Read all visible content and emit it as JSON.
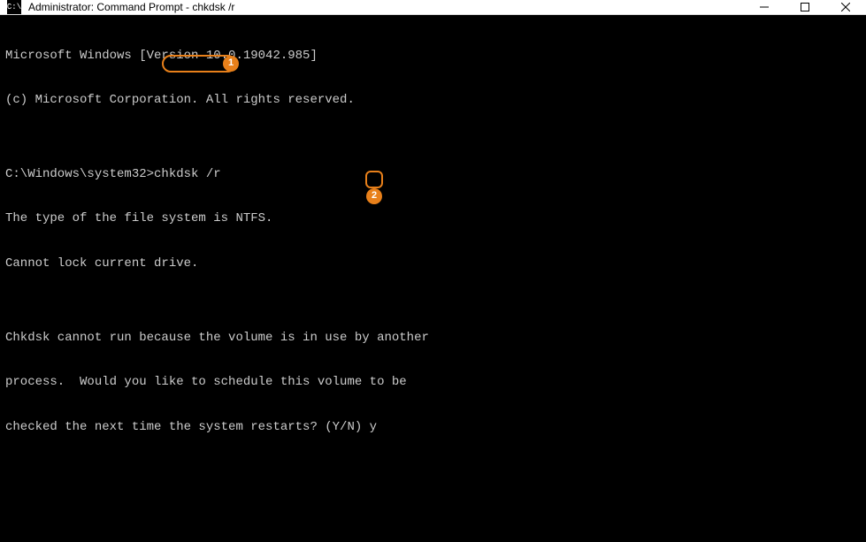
{
  "window": {
    "title": "Administrator: Command Prompt - chkdsk  /r",
    "icon_text": "C:\\"
  },
  "controls": {
    "minimize": "minimize",
    "maximize": "maximize",
    "close": "close"
  },
  "terminal": {
    "lines": [
      "Microsoft Windows [Version 10.0.19042.985]",
      "(c) Microsoft Corporation. All rights reserved.",
      "",
      "C:\\Windows\\system32>chkdsk /r",
      "The type of the file system is NTFS.",
      "Cannot lock current drive.",
      "",
      "Chkdsk cannot run because the volume is in use by another",
      "process.  Would you like to schedule this volume to be",
      "checked the next time the system restarts? (Y/N) y"
    ],
    "prompt": "C:\\Windows\\system32>",
    "command": "chkdsk /r",
    "user_input": "y"
  },
  "annotations": {
    "badge1": "1",
    "badge2": "2",
    "color": "#e8801a"
  }
}
